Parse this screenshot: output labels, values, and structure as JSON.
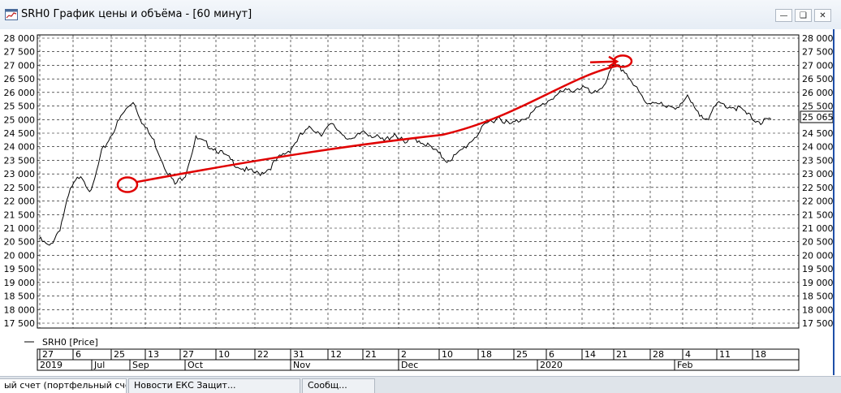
{
  "window": {
    "title": "SRH0 График цены и объёма - [60 минут]",
    "buttons": [
      "minimize",
      "restore",
      "close"
    ]
  },
  "legend": {
    "label": "SRH0 [Price]"
  },
  "last_price": "25 065",
  "colors": {
    "price_line": "#000000",
    "annotation": "#e00000",
    "grid": "#000000"
  },
  "chart_data": {
    "type": "line",
    "ylim": [
      17500,
      28000
    ],
    "y_ticks": [
      "28 000",
      "27 500",
      "27 000",
      "26 500",
      "26 000",
      "25 500",
      "25 000",
      "24 500",
      "24 000",
      "23 500",
      "23 000",
      "22 500",
      "22 000",
      "21 500",
      "21 000",
      "20 500",
      "20 000",
      "19 500",
      "19 000",
      "18 500",
      "18 000",
      "17 500"
    ],
    "x_day_ticks": [
      "27",
      "6",
      "25",
      "13",
      "27",
      "10",
      "22",
      "31",
      "12",
      "21",
      "2",
      "10",
      "18",
      "25",
      "6",
      "14",
      "21",
      "28",
      "4",
      "11",
      "18"
    ],
    "x_month_labels": [
      "2019",
      "Jul",
      "Sep",
      "Oct",
      "Nov",
      "Dec",
      "2020",
      "Feb"
    ],
    "series": [
      {
        "values": [
          20600,
          20300,
          21000,
          22400,
          23000,
          22300,
          23800,
          24500,
          25200,
          25700,
          24800,
          24200,
          23300,
          22600,
          23000,
          24300,
          24100,
          23900,
          23600,
          23300,
          23100,
          23000,
          23200,
          23600,
          23900,
          24400,
          24700,
          24500,
          24800,
          24500,
          24200,
          24600,
          24400,
          24200,
          24500,
          24100,
          24300,
          24100,
          23800,
          23500,
          23700,
          24100,
          24500,
          24900,
          25100,
          24800,
          25000,
          25200,
          25500,
          25800,
          26000,
          26100,
          26200,
          25900,
          26300,
          27000,
          26800,
          26200,
          25600,
          25700,
          25400,
          25500,
          25800,
          25200,
          25100,
          25600,
          25500,
          25400,
          25100,
          24900,
          25000
        ]
      }
    ],
    "annotations": [
      {
        "type": "circle",
        "x": "Aug 2019",
        "y": 22600
      },
      {
        "type": "circle",
        "x": "Jan 2020",
        "y": 27150
      },
      {
        "type": "trend-arrow",
        "from": 22700,
        "to": 26900
      }
    ]
  },
  "tabs": [
    {
      "label": "ый счет (портфельный счет)"
    },
    {
      "label": "Новости ЕКС Защит..."
    },
    {
      "label": "Сообщ..."
    }
  ]
}
